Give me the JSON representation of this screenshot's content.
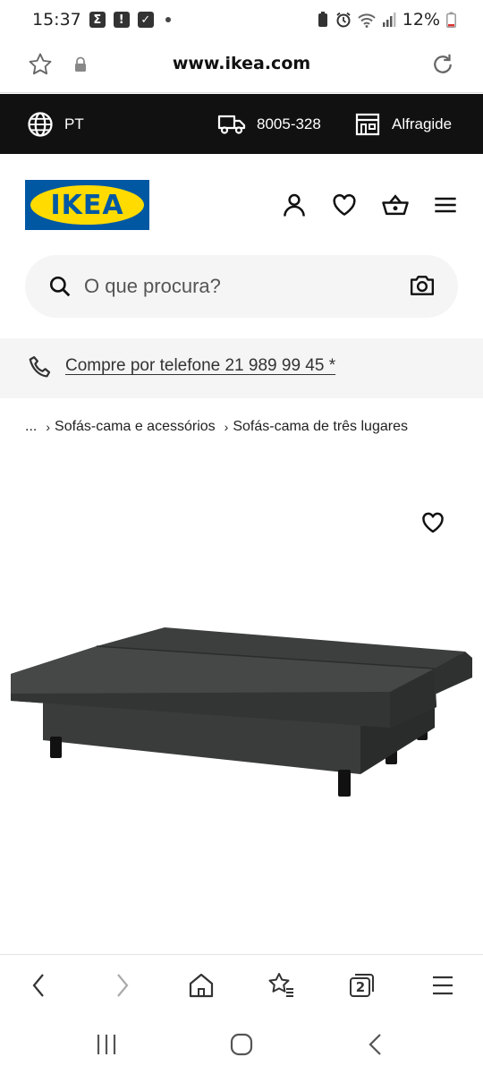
{
  "status_bar": {
    "time": "15:37",
    "battery": "12%"
  },
  "browser": {
    "url": "www.ikea.com",
    "tabs_count": "2"
  },
  "topbar": {
    "language": "PT",
    "phone": "8005-328",
    "store": "Alfragide"
  },
  "brand": {
    "logo_text": "IKEA"
  },
  "search": {
    "placeholder": "O que procura?"
  },
  "promo": {
    "text": "Compre por telefone 21 989 99 45 *"
  },
  "breadcrumb": {
    "ellipsis": "...",
    "items": [
      "Sofás-cama e acessórios",
      "Sofás-cama de três lugares"
    ]
  },
  "colors": {
    "ikea_blue": "#0058a3",
    "ikea_yellow": "#ffdb00",
    "topbar_bg": "#111111"
  }
}
